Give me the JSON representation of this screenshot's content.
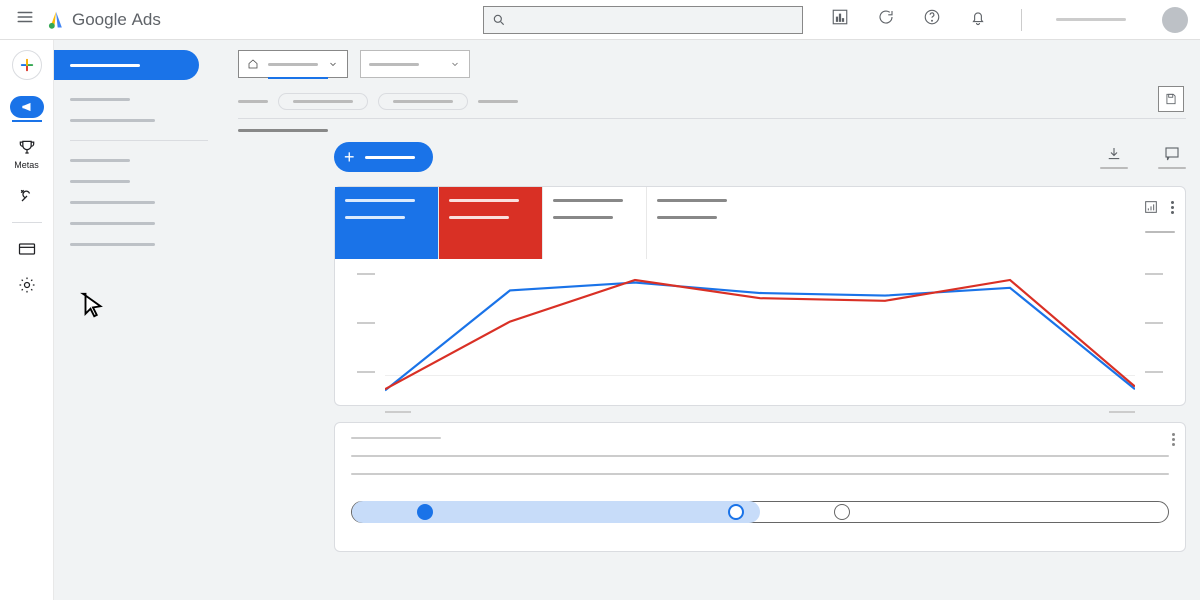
{
  "header": {
    "brand_a": "Google",
    "brand_b": "Ads"
  },
  "rail": {
    "metas_label": "Metas"
  },
  "colors": {
    "blue": "#1a73e8",
    "red": "#d93025"
  },
  "chart_data": {
    "type": "line",
    "x": [
      0,
      1,
      2,
      3,
      4,
      5,
      6
    ],
    "series": [
      {
        "name": "metric-blue",
        "color": "#1a73e8",
        "values": [
          5,
          82,
          88,
          80,
          78,
          84,
          6
        ]
      },
      {
        "name": "metric-red",
        "color": "#d93025",
        "values": [
          6,
          58,
          90,
          76,
          74,
          90,
          8
        ]
      }
    ],
    "ylim": [
      0,
      100
    ],
    "gridlines_y": [
      0,
      50,
      100
    ]
  },
  "slider": {
    "fill_percent": 50,
    "nodes": [
      {
        "pos": 9,
        "state": "filled"
      },
      {
        "pos": 47,
        "state": "outlined-blue"
      },
      {
        "pos": 60,
        "state": "outlined-gray"
      }
    ]
  }
}
